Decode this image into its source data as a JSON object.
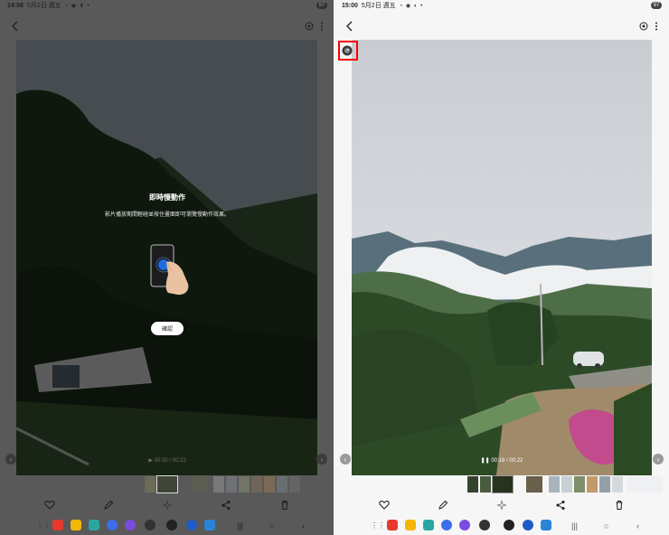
{
  "left": {
    "status": {
      "time": "14:58",
      "date": "5月2日 週五",
      "battery": "97"
    },
    "overlay": {
      "title": "即時慢動作",
      "description": "影片播放期間輕碰並按住畫面即可瀏覽慢動作效果。",
      "confirm_label": "確認"
    },
    "playback": {
      "current": "00:00",
      "total": "00:22"
    }
  },
  "right": {
    "status": {
      "time": "15:00",
      "date": "5月2日 週五",
      "battery": "97"
    },
    "playback": {
      "current": "00:19",
      "total": "00:22"
    }
  },
  "icons": {
    "back": "back-arrow-icon",
    "motion": "motion-photo-icon",
    "more": "more-vertical-icon",
    "favorite": "heart-icon",
    "edit": "pencil-icon",
    "effects": "sparkle-icon",
    "share": "share-icon",
    "delete": "trash-icon"
  },
  "colors": {
    "highlight": "#ff0000",
    "touch": "#1e6de0"
  }
}
